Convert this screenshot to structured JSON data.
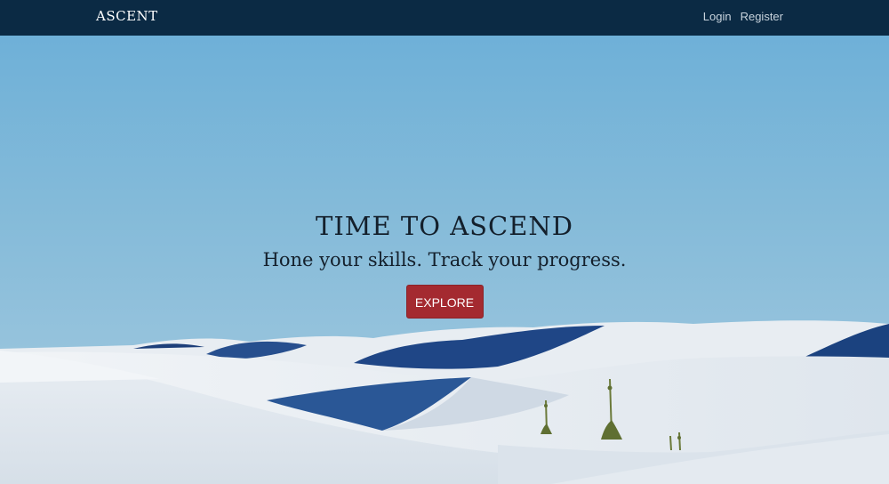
{
  "nav": {
    "brand": "ASCENT",
    "links": [
      {
        "label": "Login"
      },
      {
        "label": "Register"
      }
    ]
  },
  "hero": {
    "title": "TIME TO ASCEND",
    "subtitle": "Hone your skills. Track your progress.",
    "cta_label": "EXPLORE",
    "background": "white-sand-dunes-photo"
  },
  "colors": {
    "navbar": "#0b2a44",
    "sky": "#7db6d9",
    "cta": "#a42a30",
    "text": "#14202c"
  }
}
